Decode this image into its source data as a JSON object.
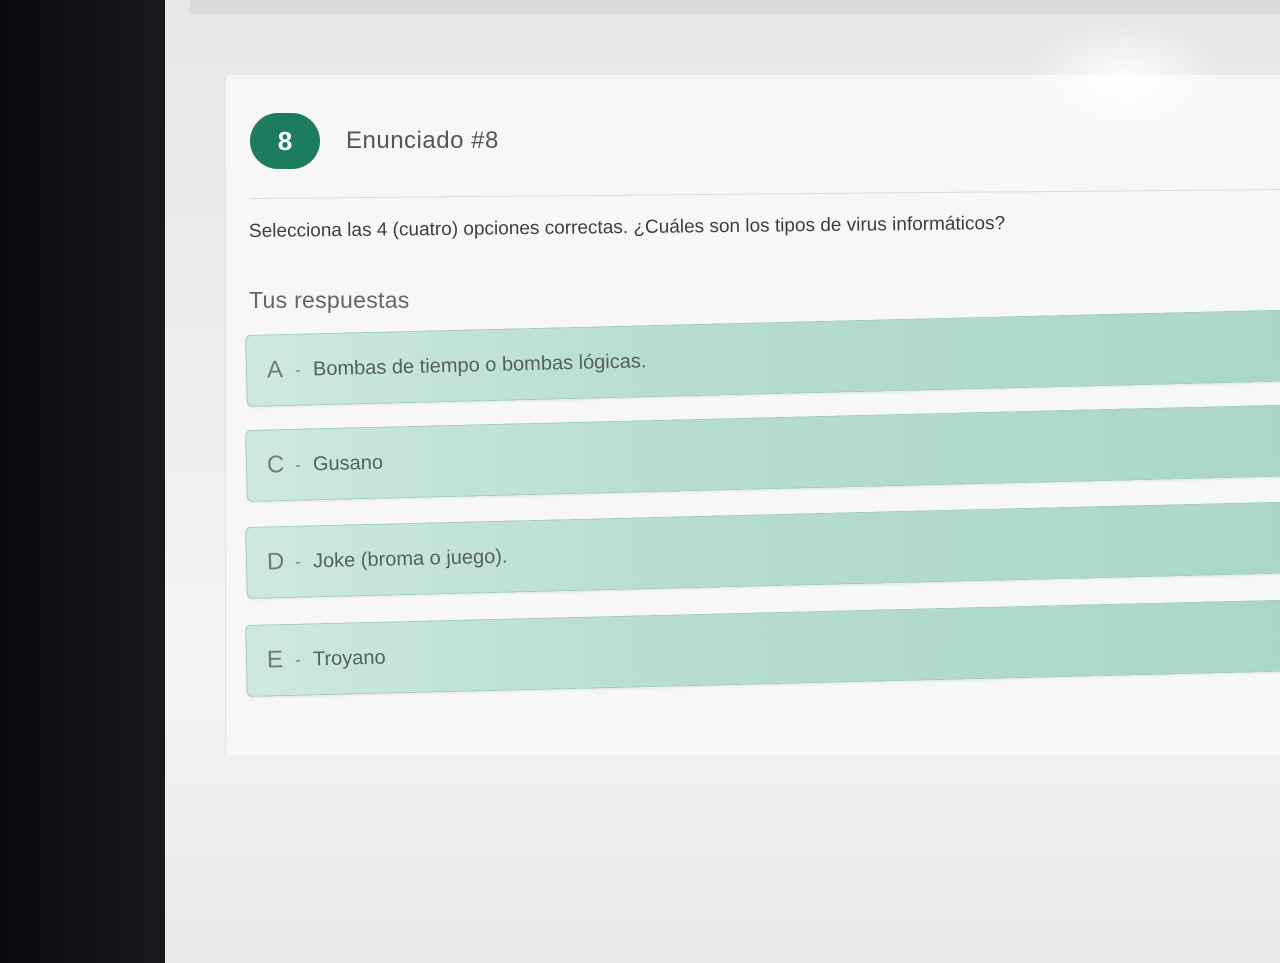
{
  "question": {
    "number": "8",
    "title": "Enunciado #8",
    "prompt": "Selecciona las 4 (cuatro) opciones correctas. ¿Cuáles son los tipos de virus informáticos?"
  },
  "answers_label": "Tus respuestas",
  "answers": [
    {
      "letter": "A",
      "separator": "-",
      "text": "Bombas de tiempo o bombas lógicas."
    },
    {
      "letter": "C",
      "separator": "-",
      "text": "Gusano"
    },
    {
      "letter": "D",
      "separator": "-",
      "text": "Joke (broma o juego)."
    },
    {
      "letter": "E",
      "separator": "-",
      "text": "Troyano"
    }
  ],
  "colors": {
    "accent": "#1d7c5f",
    "answer_bg": "#b6ddd0",
    "answer_border": "#9ccab9"
  }
}
